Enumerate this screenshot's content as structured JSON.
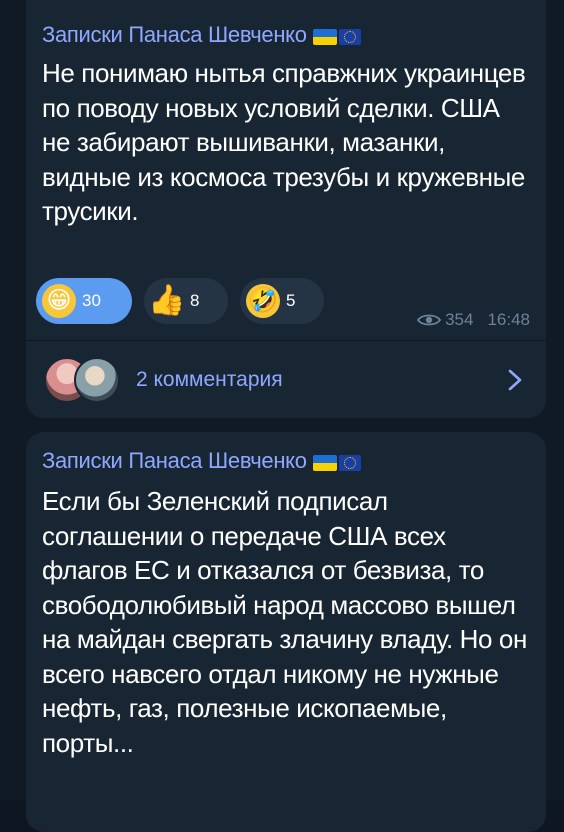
{
  "colors": {
    "background": "#0e1621",
    "bubble": "#182533",
    "author": "#8fa8ff",
    "text": "#ffffff",
    "reaction_active": "#5b9cf0",
    "reaction": "#253444",
    "meta": "#6d8296"
  },
  "messages": [
    {
      "author": "Записки Панаса Шевченко",
      "text": "Не понимаю нытья справжних украинцев по поводу новых условий сделки. США не забирают вышиванки, мазанки, видные из космоса трезубы и кружевные трусики.",
      "reactions": [
        {
          "icon": "grinning-face-icon",
          "count": "30",
          "active": true
        },
        {
          "icon": "thumbs-up-icon",
          "count": "8",
          "active": false
        },
        {
          "icon": "rofl-face-icon",
          "count": "5",
          "active": false
        }
      ],
      "views": "354",
      "time": "16:48",
      "comments_label": "2 комментария"
    },
    {
      "author": "Записки Панаса Шевченко",
      "text": "Если бы Зеленский подписал соглашении о передаче США всех флагов ЕС и отказался от безвиза, то свободолюбивый народ массово вышел на майдан свергать злачину владу. Но он всего навсего отдал никому не нужные нефть, газ, полезные ископаемые, порты..."
    }
  ]
}
